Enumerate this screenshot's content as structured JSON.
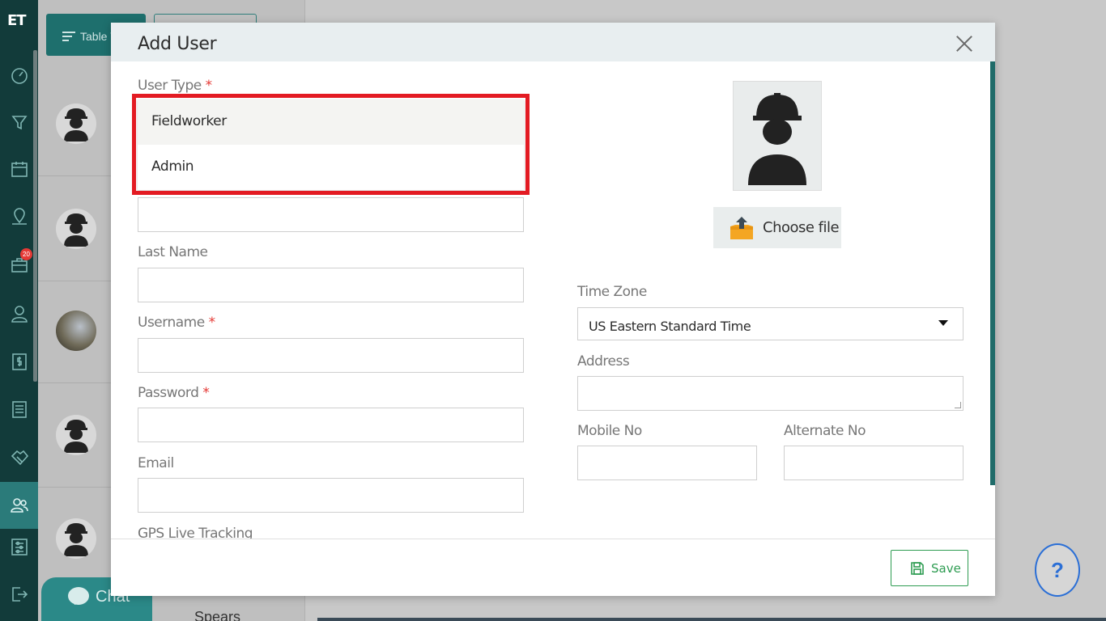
{
  "app": {
    "logo": "ET"
  },
  "background": {
    "table_view_label": "Table V",
    "chat_label": "Chat",
    "partial_name": "Spears",
    "nav_badge_count": "20"
  },
  "help": {
    "label": "?"
  },
  "modal": {
    "title": "Add User",
    "user_type": {
      "label": "User Type",
      "required": "*",
      "options": [
        "Fieldworker",
        "Admin"
      ],
      "highlighted": "Fieldworker"
    },
    "last_name": {
      "label": "Last Name",
      "value": ""
    },
    "username": {
      "label": "Username",
      "required": "*",
      "value": ""
    },
    "password": {
      "label": "Password",
      "required": "*",
      "value": ""
    },
    "email": {
      "label": "Email",
      "value": ""
    },
    "gps": {
      "label": "GPS Live Tracking"
    },
    "photo": {
      "choose_file_label": "Choose file"
    },
    "time_zone": {
      "label": "Time Zone",
      "value": "US Eastern Standard Time"
    },
    "address": {
      "label": "Address",
      "value": ""
    },
    "mobile": {
      "label": "Mobile No",
      "value": ""
    },
    "alternate": {
      "label": "Alternate No",
      "value": ""
    },
    "save_label": "Save"
  },
  "colors": {
    "rail": "#123b3a",
    "accent": "#1e6f6d",
    "highlight_frame": "#e31b23",
    "save": "#2e9c52"
  }
}
